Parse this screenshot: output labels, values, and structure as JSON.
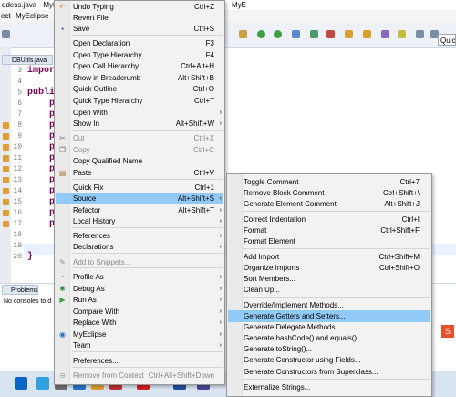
{
  "window": {
    "title_fragment": "ddess.java - MyEc",
    "title_fragment_2": "MyE"
  },
  "menubar": {
    "item_1": "ect",
    "item_2": "MyEclipse"
  },
  "quick_access": {
    "value": "Quick"
  },
  "editor": {
    "tab_label": "DBUtils.java",
    "line_numbers": [
      "3",
      "4",
      "5",
      "6",
      "7",
      "8",
      "9",
      "10",
      "11",
      "12",
      "13",
      "14",
      "15",
      "16",
      "17",
      "18",
      "19",
      "20"
    ],
    "code_lines": [
      "impor",
      "",
      "publi",
      "p",
      "p",
      "p",
      "p",
      "p",
      "p",
      "p",
      "p",
      "p",
      "p",
      "p",
      "p",
      "",
      "",
      "}"
    ]
  },
  "bottom_panel": {
    "tab_label": "Problems",
    "message": "No consoles to d"
  },
  "context_menu": {
    "items": [
      {
        "icon": "undo-icon",
        "label": "Undo Typing",
        "shortcut": "Ctrl+Z"
      },
      {
        "label": "Revert File",
        "shortcut": ""
      },
      {
        "icon": "save-icon",
        "label": "Save",
        "shortcut": "Ctrl+S"
      },
      {
        "label": "Open Declaration",
        "shortcut": "F3"
      },
      {
        "label": "Open Type Hierarchy",
        "shortcut": "F4"
      },
      {
        "label": "Open Call Hierarchy",
        "shortcut": "Ctrl+Alt+H"
      },
      {
        "label": "Show in Breadcrumb",
        "shortcut": "Alt+Shift+B"
      },
      {
        "label": "Quick Outline",
        "shortcut": "Ctrl+O"
      },
      {
        "label": "Quick Type Hierarchy",
        "shortcut": "Ctrl+T"
      },
      {
        "label": "Open With",
        "shortcut": ""
      },
      {
        "label": "Show In",
        "shortcut": "Alt+Shift+W"
      },
      {
        "icon": "cut-icon",
        "label": "Cut",
        "shortcut": "Ctrl+X"
      },
      {
        "icon": "copy-icon",
        "label": "Copy",
        "shortcut": "Ctrl+C"
      },
      {
        "label": "Copy Qualified Name",
        "shortcut": ""
      },
      {
        "icon": "paste-icon",
        "label": "Paste",
        "shortcut": "Ctrl+V"
      },
      {
        "label": "Quick Fix",
        "shortcut": "Ctrl+1"
      },
      {
        "label": "Source",
        "shortcut": "Alt+Shift+S"
      },
      {
        "label": "Refactor",
        "shortcut": "Alt+Shift+T"
      },
      {
        "label": "Local History",
        "shortcut": ""
      },
      {
        "label": "References",
        "shortcut": ""
      },
      {
        "label": "Declarations",
        "shortcut": ""
      },
      {
        "icon": "snippet-icon",
        "label": "Add to Snippets...",
        "shortcut": ""
      },
      {
        "icon": "profile-icon",
        "label": "Profile As",
        "shortcut": ""
      },
      {
        "icon": "debug-icon",
        "label": "Debug As",
        "shortcut": ""
      },
      {
        "icon": "run-icon",
        "label": "Run As",
        "shortcut": ""
      },
      {
        "label": "Compare With",
        "shortcut": ""
      },
      {
        "label": "Replace With",
        "shortcut": ""
      },
      {
        "icon": "myeclipse-icon",
        "label": "MyEclipse",
        "shortcut": ""
      },
      {
        "label": "Team",
        "shortcut": ""
      },
      {
        "label": "Preferences...",
        "shortcut": ""
      },
      {
        "icon": "remove-context-icon",
        "label": "Remove from Context",
        "shortcut": "Ctrl+Alt+Shift+Down"
      }
    ]
  },
  "source_submenu": {
    "items": [
      {
        "label": "Toggle Comment",
        "shortcut": "Ctrl+7"
      },
      {
        "label": "Remove Block Comment",
        "shortcut": "Ctrl+Shift+\\"
      },
      {
        "label": "Generate Element Comment",
        "shortcut": "Alt+Shift+J"
      },
      {
        "label": "Correct Indentation",
        "shortcut": "Ctrl+I"
      },
      {
        "label": "Format",
        "shortcut": "Ctrl+Shift+F"
      },
      {
        "label": "Format Element",
        "shortcut": ""
      },
      {
        "label": "Add Import",
        "shortcut": "Ctrl+Shift+M"
      },
      {
        "label": "Organize Imports",
        "shortcut": "Ctrl+Shift+O"
      },
      {
        "label": "Sort Members...",
        "shortcut": ""
      },
      {
        "label": "Clean Up...",
        "shortcut": ""
      },
      {
        "label": "Override/Implement Methods...",
        "shortcut": ""
      },
      {
        "label": "Generate Getters and Setters...",
        "shortcut": ""
      },
      {
        "label": "Generate Delegate Methods...",
        "shortcut": ""
      },
      {
        "label": "Generate hashCode() and equals()...",
        "shortcut": ""
      },
      {
        "label": "Generate toString()...",
        "shortcut": ""
      },
      {
        "label": "Generate Constructor using Fields...",
        "shortcut": ""
      },
      {
        "label": "Generate Constructors from Superclass...",
        "shortcut": ""
      },
      {
        "label": "Externalize Strings...",
        "shortcut": ""
      }
    ]
  },
  "colors": {
    "selection": "#91c9f7",
    "menu_bg": "#f2f2f2",
    "keyword": "#7f0055"
  }
}
